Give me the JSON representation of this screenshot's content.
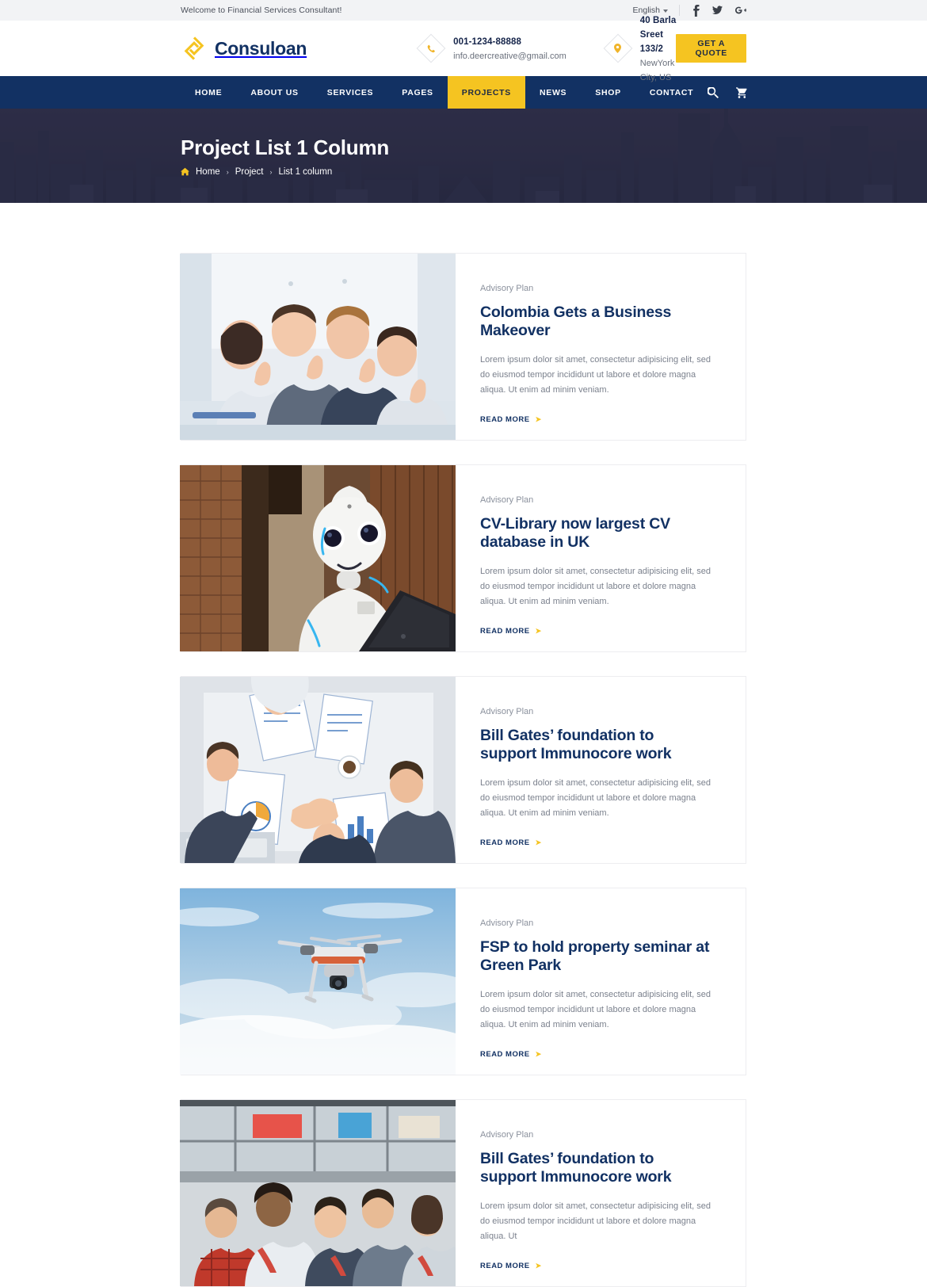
{
  "topbar": {
    "welcome": "Welcome to Financial Services Consultant!",
    "language": "English",
    "social": [
      {
        "name": "facebook-icon",
        "label": "f"
      },
      {
        "name": "twitter-icon",
        "label": "t"
      },
      {
        "name": "google-plus-icon",
        "label": "g+"
      }
    ]
  },
  "header": {
    "brand": "Consuloan",
    "contacts": [
      {
        "icon": "phone-icon",
        "line1": "001-1234-88888",
        "line2": "info.deercreative@gmail.com"
      },
      {
        "icon": "map-marker-icon",
        "line1": "40 Barla Sreet 133/2",
        "line2": "NewYork City, US"
      }
    ],
    "quote_label": "GET A QUOTE"
  },
  "nav": {
    "items": [
      {
        "label": "HOME",
        "active": false
      },
      {
        "label": "ABOUT US",
        "active": false
      },
      {
        "label": "SERVICES",
        "active": false
      },
      {
        "label": "PAGES",
        "active": false
      },
      {
        "label": "PROJECTS",
        "active": true
      },
      {
        "label": "NEWS",
        "active": false
      },
      {
        "label": "SHOP",
        "active": false
      },
      {
        "label": "CONTACT",
        "active": false
      }
    ],
    "icons": [
      {
        "name": "search-icon"
      },
      {
        "name": "cart-icon"
      }
    ]
  },
  "hero": {
    "title": "Project List 1 Column",
    "breadcrumb": [
      {
        "label": "Home",
        "link": true
      },
      {
        "label": "Project",
        "link": true
      },
      {
        "label": "List 1 column",
        "link": false
      }
    ],
    "separator": "›"
  },
  "projects": [
    {
      "category": "Advisory Plan",
      "title": "Colombia Gets a Business Makeover",
      "excerpt": "Lorem ipsum dolor sit amet, consectetur adipisicing elit, sed do eiusmod tempor incididunt ut labore et dolore magna aliqua. Ut enim ad minim veniam.",
      "read_more": "READ MORE",
      "image": "team-thumbs-up"
    },
    {
      "category": "Advisory Plan",
      "title": "CV-Library now largest CV database in UK",
      "excerpt": "Lorem ipsum dolor sit amet, consectetur adipisicing elit, sed do eiusmod tempor incididunt ut labore et dolore magna aliqua. Ut enim ad minim veniam.",
      "read_more": "READ MORE",
      "image": "white-robot"
    },
    {
      "category": "Advisory Plan",
      "title": "Bill Gates’ foundation to support Immunocore work",
      "excerpt": "Lorem ipsum dolor sit amet, consectetur adipisicing elit, sed do eiusmod tempor incididunt ut labore et dolore magna aliqua. Ut enim ad minim veniam.",
      "read_more": "READ MORE",
      "image": "business-meeting-handshake"
    },
    {
      "category": "Advisory Plan",
      "title": "FSP to hold property seminar at Green Park",
      "excerpt": "Lorem ipsum dolor sit amet, consectetur adipisicing elit, sed do eiusmod tempor incididunt ut labore et dolore magna aliqua. Ut enim ad minim veniam.",
      "read_more": "READ MORE",
      "image": "drone-in-sky"
    },
    {
      "category": "Advisory Plan",
      "title": "Bill Gates’ foundation to support Immunocore work",
      "excerpt": "Lorem ipsum dolor sit amet, consectetur adipisicing elit, sed do eiusmod tempor incididunt ut labore et dolore magna aliqua. Ut",
      "read_more": "READ MORE",
      "image": "students-classroom"
    }
  ],
  "colors": {
    "brand_navy": "#123163",
    "brand_yellow": "#f5c421",
    "topbar_bg": "#f2f3f5",
    "body_text": "#7b818d",
    "hero_bg": "#2d2e42"
  }
}
